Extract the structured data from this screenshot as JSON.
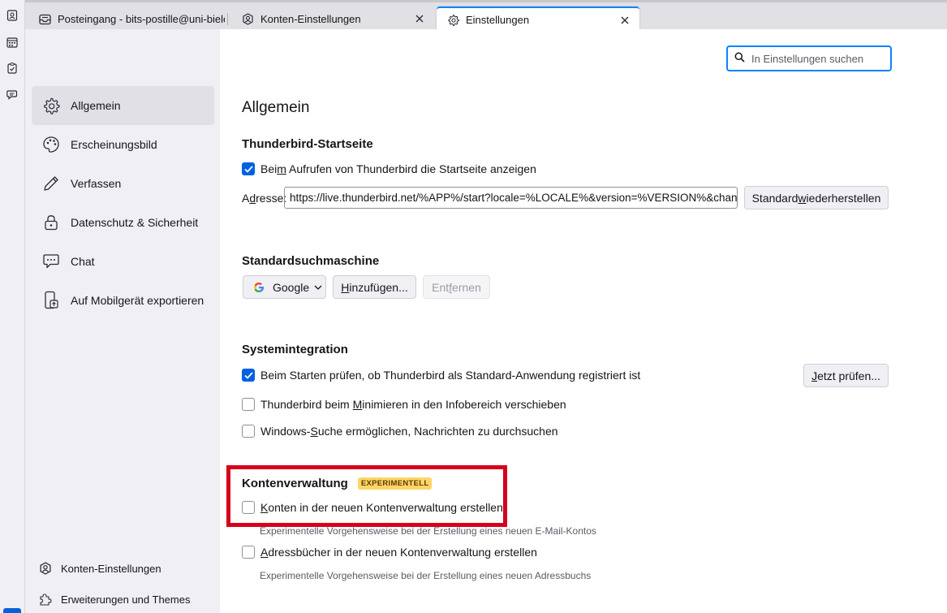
{
  "tabs": [
    {
      "label": "Posteingang - bits-postille@uni-bielefeld.de",
      "icon": "inbox-icon"
    },
    {
      "label": "Konten-Einstellungen",
      "icon": "account-settings-icon"
    },
    {
      "label": "Einstellungen",
      "icon": "gear-icon"
    }
  ],
  "search": {
    "placeholder": "In Einstellungen suchen"
  },
  "sidebar": {
    "items": [
      {
        "label": "Allgemein",
        "icon": "gear-icon"
      },
      {
        "label": "Erscheinungsbild",
        "icon": "palette-icon"
      },
      {
        "label": "Verfassen",
        "icon": "pencil-icon"
      },
      {
        "label": "Datenschutz & Sicherheit",
        "icon": "lock-icon"
      },
      {
        "label": "Chat",
        "icon": "chat-icon"
      },
      {
        "label": "Auf Mobilgerät exportieren",
        "icon": "mobile-export-icon"
      }
    ],
    "footer": [
      {
        "label": "Konten-Einstellungen",
        "icon": "account-settings-icon"
      },
      {
        "label": "Erweiterungen und Themes",
        "icon": "puzzle-icon"
      }
    ]
  },
  "page": {
    "title": "Allgemein"
  },
  "startpage": {
    "heading": "Thunderbird-Startseite",
    "checkbox_pre": "Bei",
    "checkbox_acc": "m",
    "checkbox_post": " Aufrufen von Thunderbird die Startseite anzeigen",
    "checked": true,
    "address_pre": "A",
    "address_acc": "d",
    "address_post": "resse:",
    "address_value": "https://live.thunderbird.net/%APP%/start?locale=%LOCALE%&version=%VERSION%&channel=%CHANNEL%",
    "restore_pre": "Standard ",
    "restore_acc": "w",
    "restore_post": "iederherstellen"
  },
  "search_engine": {
    "heading": "Standardsuchmaschine",
    "selected": "Google",
    "add_pre": "",
    "add_acc": "H",
    "add_post": "inzufügen...",
    "remove_pre": "Ent",
    "remove_acc": "f",
    "remove_post": "ernen"
  },
  "system": {
    "heading": "Systemintegration",
    "check_default": "Beim Starten prüfen, ob Thunderbird als Standard-Anwendung registriert ist",
    "check_default_checked": true,
    "check_now_pre": "",
    "check_now_acc": "J",
    "check_now_post": "etzt prüfen...",
    "minimize_pre": "Thunderbird beim ",
    "minimize_acc": "M",
    "minimize_post": "inimieren in den Infobereich verschieben",
    "windows_pre": "Windows-",
    "windows_acc": "S",
    "windows_post": "uche ermöglichen, Nachrichten zu durchsuchen"
  },
  "account_mgmt": {
    "heading": "Kontenverwaltung",
    "badge": "EXPERIMENTELL",
    "accounts_pre": "",
    "accounts_acc": "K",
    "accounts_post": "onten in der neuen Kontenverwaltung erstellen",
    "accounts_desc": "Experimentelle Vorgehensweise bei der Erstellung eines neuen E-Mail-Kontos",
    "addressbooks_pre": "",
    "addressbooks_acc": "A",
    "addressbooks_post": "dressbücher in der neuen Kontenverwaltung erstellen",
    "addressbooks_desc": "Experimentelle Vorgehensweise bei der Erstellung eines neuen Adressbuchs"
  },
  "colors": {
    "accent": "#0a84ff",
    "checkbox": "#0061e0",
    "highlight": "#d6001c",
    "badge": "#ffd567"
  }
}
